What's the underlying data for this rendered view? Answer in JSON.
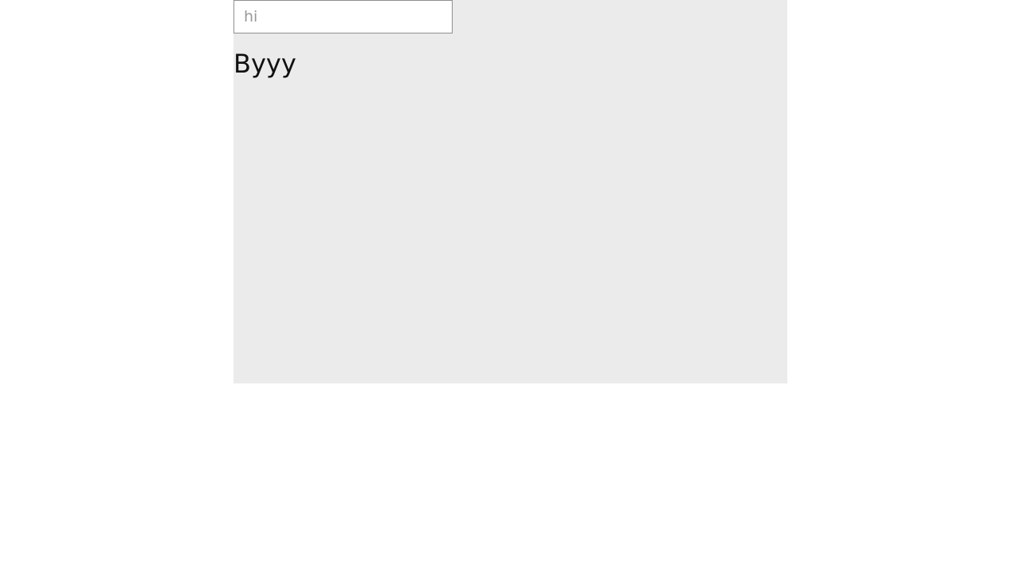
{
  "search": {
    "value": "",
    "placeholder": "hi"
  },
  "content": {
    "heading": "Byyy"
  },
  "colors": {
    "page_background": "#ffffff",
    "panel_background": "#ebebeb",
    "input_border": "#8f8f8f",
    "placeholder_text": "#9a9a9a",
    "heading_text": "#111111"
  }
}
